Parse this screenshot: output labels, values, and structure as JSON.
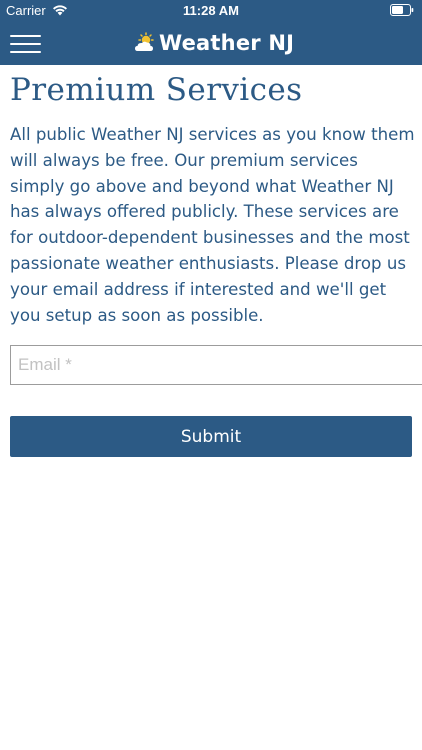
{
  "status_bar": {
    "carrier": "Carrier",
    "time": "11:28 AM",
    "wifi_icon": "wifi-icon",
    "battery_icon": "battery-icon"
  },
  "header": {
    "menu_icon": "hamburger-menu-icon",
    "logo_icon": "sun-cloud-icon",
    "title": "Weather NJ",
    "background_color": "#2c5a85"
  },
  "content": {
    "title": "Premium Services",
    "intro": "All public Weather NJ services as you know them will always be free. Our premium services simply go above and beyond what Weather NJ has always offered publicly. These services are for outdoor-dependent businesses and the most passionate weather enthusiasts.  Please drop us your email address if interested and we'll get you setup as soon as possible.",
    "text_color": "#2c5a85"
  },
  "form": {
    "email_placeholder": "Email *",
    "email_value": "",
    "submit_label": "Submit"
  }
}
